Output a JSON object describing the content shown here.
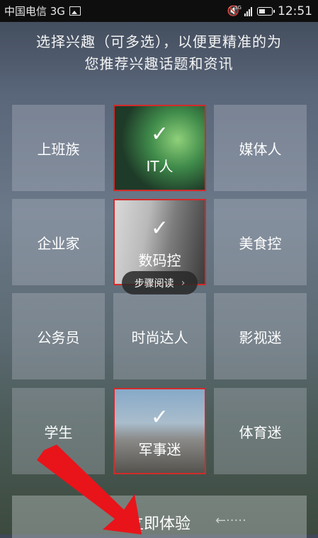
{
  "status_bar": {
    "carrier": "中国电信 3G",
    "network_label": "3G",
    "time": "12:51"
  },
  "header": {
    "line1": "选择兴趣（可多选），以便更精准的为",
    "line2": "您推荐兴趣话题和资讯"
  },
  "tiles": [
    {
      "label": "上班族",
      "selected": false
    },
    {
      "label": "IT人",
      "selected": true
    },
    {
      "label": "媒体人",
      "selected": false
    },
    {
      "label": "企业家",
      "selected": false
    },
    {
      "label": "数码控",
      "selected": true
    },
    {
      "label": "美食控",
      "selected": false
    },
    {
      "label": "公务员",
      "selected": false
    },
    {
      "label": "时尚达人",
      "selected": false
    },
    {
      "label": "影视迷",
      "selected": false
    },
    {
      "label": "学生",
      "selected": false
    },
    {
      "label": "军事迷",
      "selected": true
    },
    {
      "label": "体育迷",
      "selected": false
    }
  ],
  "check_mark": "✓",
  "guide_pill": {
    "label": "步骤阅读",
    "chevron": "›"
  },
  "bottom": {
    "cta_label": "立即体验",
    "hint": "←·····"
  },
  "colors": {
    "selected_border": "#d42a2a",
    "annotation_arrow": "#e8141a"
  }
}
